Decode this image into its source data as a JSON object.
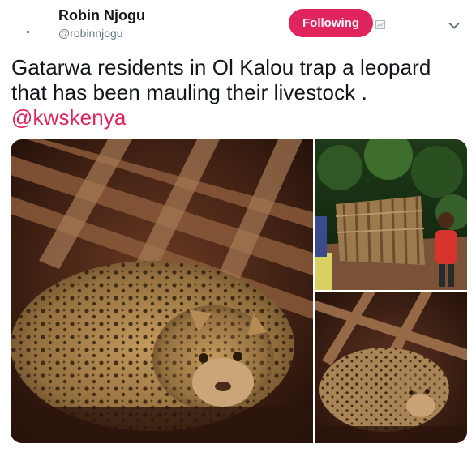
{
  "tweet": {
    "author": {
      "name": "Robin Njogu",
      "handle": "@robinnjogu"
    },
    "follow_button": {
      "label": "Following",
      "color": "#e0245e"
    },
    "text": "Gatarwa residents in Ol Kalou trap a leopard that has been mauling their livestock . ",
    "mention": "@kwskenya",
    "icons": [
      "verified-badge-placeholder-icon",
      "chevron-down-icon"
    ],
    "media": [
      {
        "name": "leopard-in-cage-photo"
      },
      {
        "name": "wooden-trap-crowd-photo"
      },
      {
        "name": "leopard-closeup-photo"
      }
    ]
  }
}
